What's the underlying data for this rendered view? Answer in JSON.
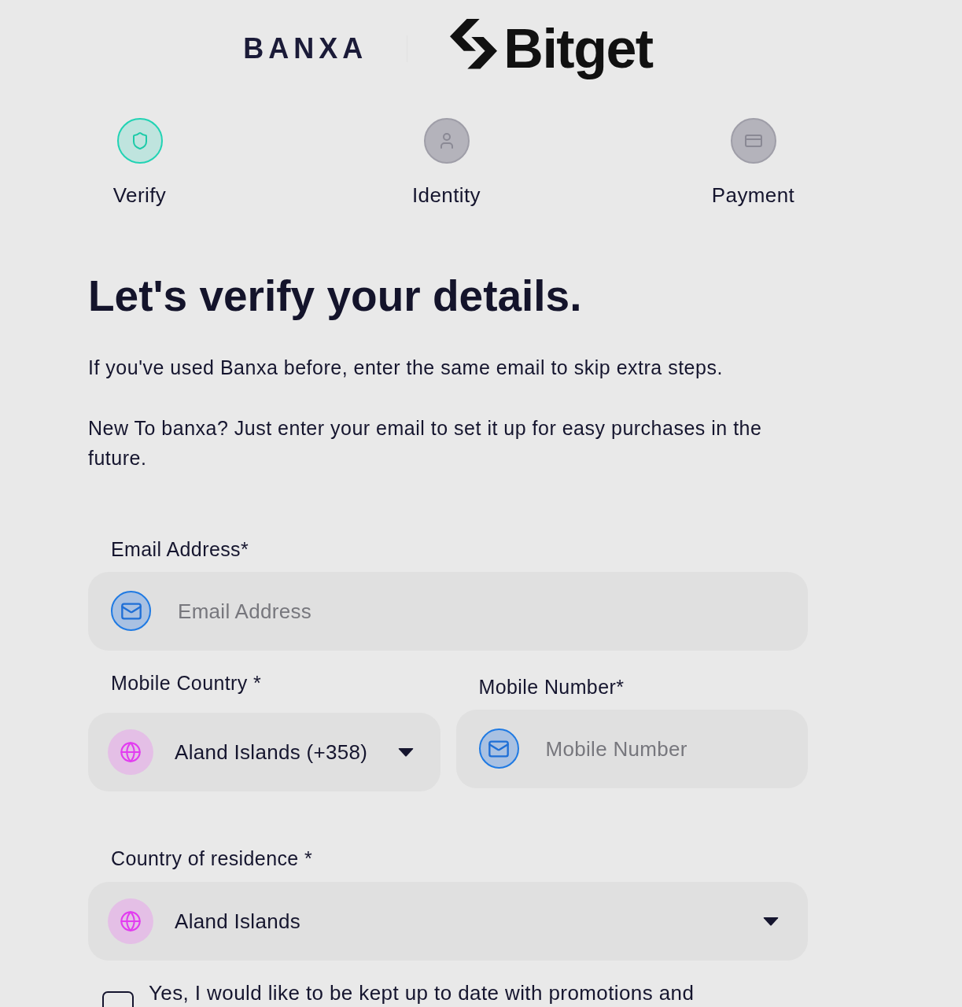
{
  "logos": {
    "partner": "BANXA",
    "brand": "Bitget"
  },
  "steps": [
    {
      "label": "Verify",
      "selected": true
    },
    {
      "label": "Identity",
      "selected": false
    },
    {
      "label": "Payment",
      "selected": false
    }
  ],
  "heading": "Let's verify your details.",
  "paragraphs": [
    "If you've used Banxa before, enter the same email to skip extra steps.",
    "New To banxa? Just enter your email to set it up for easy purchases in the future."
  ],
  "email_field": {
    "label": "Email Address*",
    "placeholder": "Email Address"
  },
  "mobile_country_field": {
    "label": "Mobile Country *",
    "value": "Aland Islands (+358)"
  },
  "mobile_number_field": {
    "label": "Mobile Number*",
    "placeholder": "Mobile Number"
  },
  "residence_field": {
    "label": "Country of residence *",
    "value": "Aland Islands"
  },
  "consent": {
    "text": "Yes, I would like to be kept up to date with promotions and",
    "checked": false
  }
}
